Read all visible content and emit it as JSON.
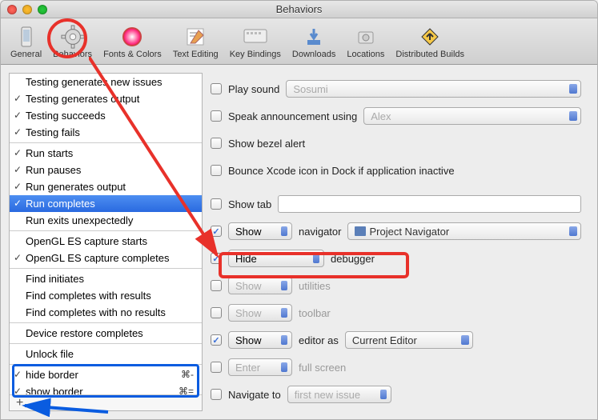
{
  "window": {
    "title": "Behaviors"
  },
  "toolbar": {
    "items": [
      {
        "label": "General"
      },
      {
        "label": "Behaviors"
      },
      {
        "label": "Fonts & Colors"
      },
      {
        "label": "Text Editing"
      },
      {
        "label": "Key Bindings"
      },
      {
        "label": "Downloads"
      },
      {
        "label": "Locations"
      },
      {
        "label": "Distributed Builds"
      }
    ]
  },
  "sidebar": {
    "groups": [
      [
        {
          "label": "Testing generates new issues",
          "checked": false
        },
        {
          "label": "Testing generates output",
          "checked": true
        },
        {
          "label": "Testing succeeds",
          "checked": true
        },
        {
          "label": "Testing fails",
          "checked": true
        }
      ],
      [
        {
          "label": "Run starts",
          "checked": true
        },
        {
          "label": "Run pauses",
          "checked": true
        },
        {
          "label": "Run generates output",
          "checked": true
        },
        {
          "label": "Run completes",
          "checked": true,
          "selected": true
        },
        {
          "label": "Run exits unexpectedly",
          "checked": false
        }
      ],
      [
        {
          "label": "OpenGL ES capture starts",
          "checked": false
        },
        {
          "label": "OpenGL ES capture completes",
          "checked": true
        }
      ],
      [
        {
          "label": "Find initiates",
          "checked": false
        },
        {
          "label": "Find completes with results",
          "checked": false
        },
        {
          "label": "Find completes with no results",
          "checked": false
        }
      ],
      [
        {
          "label": "Device restore completes",
          "checked": false
        }
      ],
      [
        {
          "label": "Unlock file",
          "checked": false
        }
      ],
      [
        {
          "label": "hide border",
          "checked": true,
          "shortcut": "⌘-"
        },
        {
          "label": "show border",
          "checked": true,
          "shortcut": "⌘="
        }
      ]
    ],
    "footer_plus": "+"
  },
  "options": {
    "play_sound": {
      "label": "Play sound",
      "value": "Sosumi",
      "checked": false
    },
    "speak": {
      "label": "Speak announcement using",
      "value": "Alex",
      "checked": false
    },
    "bezel": {
      "label": "Show bezel alert",
      "checked": false
    },
    "bounce": {
      "label": "Bounce Xcode icon in Dock if application inactive",
      "checked": false
    },
    "show_tab": {
      "label": "Show tab",
      "value": "",
      "checked": false
    },
    "navigator": {
      "checked": true,
      "action": "Show",
      "label": "navigator",
      "value": "Project Navigator"
    },
    "debugger": {
      "checked": true,
      "action": "Hide",
      "label": "debugger"
    },
    "utilities": {
      "checked": false,
      "action": "Show",
      "label": "utilities"
    },
    "toolbar": {
      "checked": false,
      "action": "Show",
      "label": "toolbar"
    },
    "editor": {
      "checked": true,
      "action": "Show",
      "label": "editor as",
      "value": "Current Editor"
    },
    "fullscreen": {
      "checked": false,
      "action": "Enter",
      "label": "full screen"
    },
    "navigate": {
      "checked": false,
      "label": "Navigate to",
      "value": "first new issue"
    }
  }
}
